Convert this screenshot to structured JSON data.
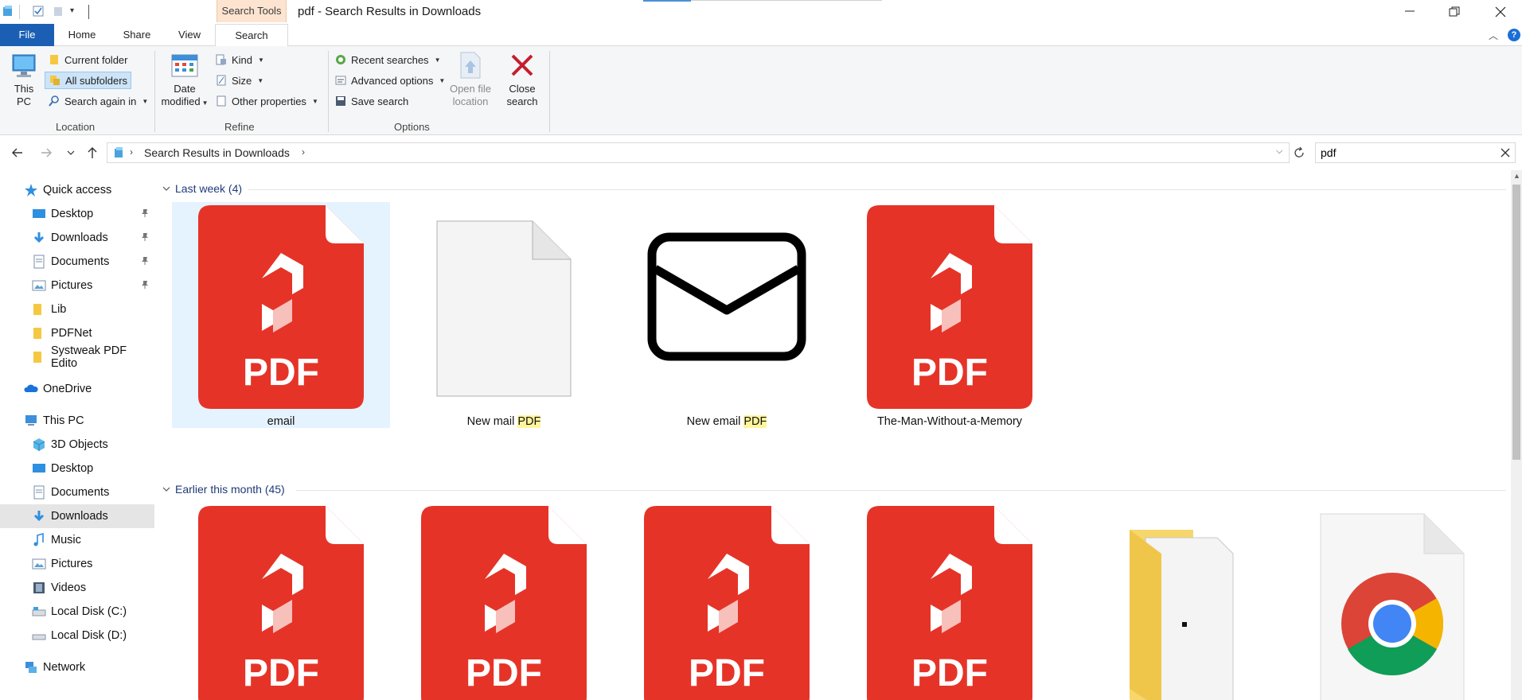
{
  "titlebar": {
    "title": "pdf - Search Results in Downloads",
    "context_tab": "Search Tools"
  },
  "ribbon_tabs": {
    "file": "File",
    "home": "Home",
    "share": "Share",
    "view": "View",
    "search": "Search"
  },
  "ribbon": {
    "location": {
      "label": "Location",
      "this_pc": [
        "This",
        "PC"
      ],
      "current_folder": "Current folder",
      "all_subfolders": "All subfolders",
      "search_again_in": "Search again in"
    },
    "refine": {
      "label": "Refine",
      "date_modified": [
        "Date",
        "modified"
      ],
      "kind": "Kind",
      "size": "Size",
      "other_properties": "Other properties"
    },
    "options": {
      "label": "Options",
      "recent_searches": "Recent searches",
      "advanced_options": "Advanced options",
      "save_search": "Save search",
      "open_file_location": [
        "Open file",
        "location"
      ],
      "close_search": [
        "Close",
        "search"
      ]
    }
  },
  "address": {
    "path": "Search Results in Downloads",
    "search_value": "pdf"
  },
  "nav_pane": {
    "quick_access": "Quick access",
    "quick_items": [
      "Desktop",
      "Downloads",
      "Documents",
      "Pictures",
      "Lib",
      "PDFNet",
      "Systweak PDF Edito"
    ],
    "onedrive": "OneDrive",
    "this_pc": "This PC",
    "pc_items": [
      "3D Objects",
      "Desktop",
      "Documents",
      "Downloads",
      "Music",
      "Pictures",
      "Videos",
      "Local Disk (C:)",
      "Local Disk (D:)"
    ],
    "network": "Network"
  },
  "groups": [
    {
      "header": "Last week (4)",
      "files": [
        {
          "name": "email",
          "type": "pdf"
        },
        {
          "name_pre": "New mail ",
          "name_hl": "PDF",
          "type": "blank"
        },
        {
          "name_pre": "New email ",
          "name_hl": "PDF",
          "type": "mail"
        },
        {
          "name": "The-Man-Without-a-Memory",
          "type": "pdf"
        }
      ]
    },
    {
      "header": "Earlier this month (45)"
    }
  ],
  "colors": {
    "accent_blue": "#1a5fb4",
    "pdf_red": "#e63328",
    "highlight": "#fff59d",
    "context_tab": "#fde4d0"
  }
}
